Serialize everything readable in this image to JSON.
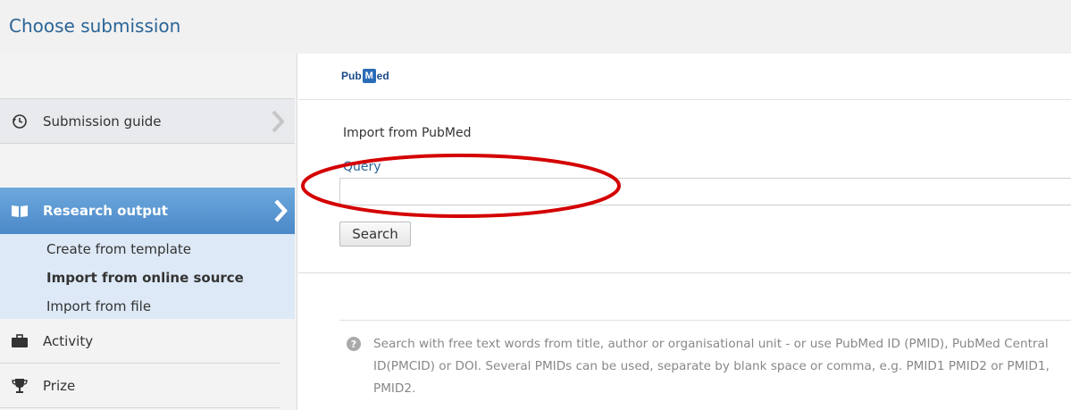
{
  "window": {
    "title": "Choose submission"
  },
  "sidebar": {
    "guide": {
      "label": "Submission guide",
      "icon": "history-icon"
    },
    "research": {
      "label": "Research output",
      "icon": "book-icon"
    },
    "sub_items": [
      {
        "label": "Create from template"
      },
      {
        "label": "Import from online source"
      },
      {
        "label": "Import from file"
      }
    ],
    "activity": {
      "label": "Activity",
      "icon": "briefcase-icon"
    },
    "prize": {
      "label": "Prize",
      "icon": "trophy-icon"
    }
  },
  "main": {
    "source_logo": {
      "text_pre": "Pub",
      "text_m": "M",
      "text_post": "ed"
    },
    "import_title": "Import from PubMed",
    "query_label": "Query",
    "query_value": "",
    "search_label": "Search",
    "help_text": "Search with free text words from title, author or organisational unit - or use PubMed ID (PMID), PubMed Central ID(PMCID) or DOI. Several PMIDs can be used, separate by blank space or comma, e.g. PMID1 PMID2 or PMID1, PMID2."
  },
  "colors": {
    "accent": "#2a6496",
    "selected_item": "#5b9bd5",
    "annotation": "#d40000"
  }
}
